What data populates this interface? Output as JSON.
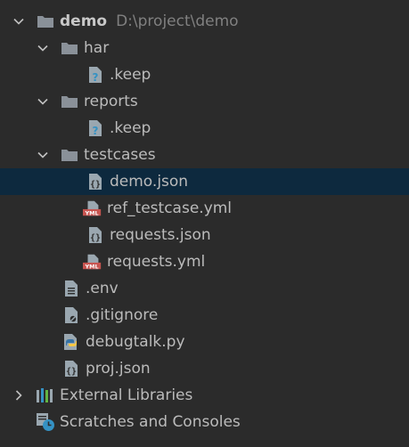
{
  "project_tree": {
    "root": {
      "name": "demo",
      "path": "D:\\project\\demo"
    },
    "har": {
      "name": "har",
      "child": ".keep"
    },
    "reports": {
      "name": "reports",
      "child": ".keep"
    },
    "testcases": {
      "name": "testcases",
      "items": [
        "demo.json",
        "ref_testcase.yml",
        "requests.json",
        "requests.yml"
      ]
    },
    "root_files": [
      ".env",
      ".gitignore",
      "debugtalk.py",
      "proj.json"
    ],
    "external_libraries": "External Libraries",
    "scratches": "Scratches and Consoles",
    "colors": {
      "background": "#2b2b2b",
      "selected_row": "#0d293e",
      "text": "#bbbbbb",
      "path_text": "#808080",
      "folder": "#8a9199",
      "yml_badge": "#c75450"
    }
  }
}
